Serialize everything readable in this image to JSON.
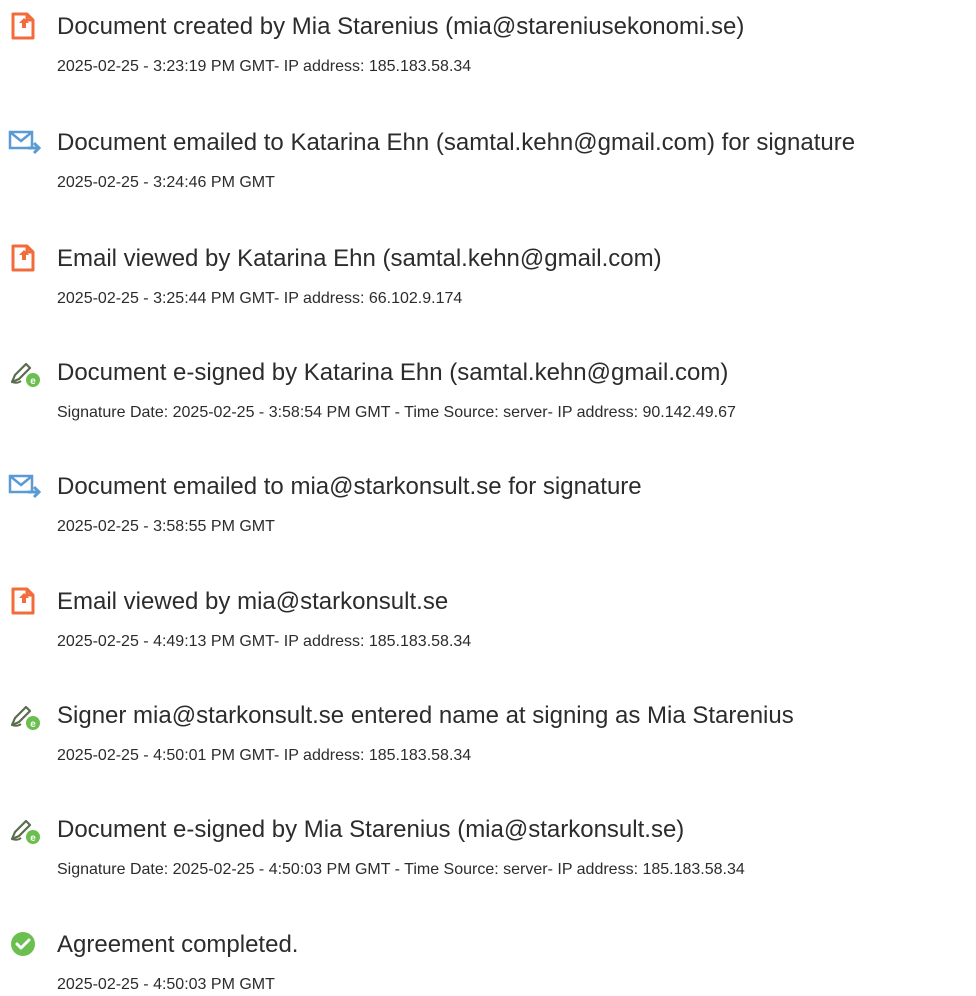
{
  "events": [
    {
      "icon": "document-created-icon",
      "title": "Document created by Mia Starenius (mia@stareniusekonomi.se)",
      "detail": "2025-02-25 - 3:23:19 PM GMT- IP address: 185.183.58.34"
    },
    {
      "icon": "email-sent-icon",
      "title": "Document emailed to Katarina Ehn (samtal.kehn@gmail.com) for signature",
      "detail": "2025-02-25 - 3:24:46 PM GMT"
    },
    {
      "icon": "document-viewed-icon",
      "title": "Email viewed by Katarina Ehn (samtal.kehn@gmail.com)",
      "detail": "2025-02-25 - 3:25:44 PM GMT- IP address: 66.102.9.174"
    },
    {
      "icon": "esign-pen-icon",
      "title": "Document e-signed by Katarina Ehn (samtal.kehn@gmail.com)",
      "detail": "Signature Date: 2025-02-25 - 3:58:54 PM GMT - Time Source: server- IP address: 90.142.49.67"
    },
    {
      "icon": "email-sent-icon",
      "title": "Document emailed to mia@starkonsult.se for signature",
      "detail": "2025-02-25 - 3:58:55 PM GMT"
    },
    {
      "icon": "document-viewed-icon",
      "title": "Email viewed by mia@starkonsult.se",
      "detail": "2025-02-25 - 4:49:13 PM GMT- IP address: 185.183.58.34"
    },
    {
      "icon": "esign-pen-icon",
      "title": "Signer mia@starkonsult.se entered name at signing as Mia Starenius",
      "detail": "2025-02-25 - 4:50:01 PM GMT- IP address: 185.183.58.34"
    },
    {
      "icon": "esign-pen-icon",
      "title": "Document e-signed by Mia Starenius (mia@starkonsult.se)",
      "detail": "Signature Date: 2025-02-25 - 4:50:03 PM GMT - Time Source: server- IP address: 185.183.58.34"
    },
    {
      "icon": "checkmark-circle-icon",
      "title": "Agreement completed.",
      "detail": "2025-02-25 - 4:50:03 PM GMT"
    }
  ],
  "colors": {
    "document_icon": "#f26b3a",
    "email_icon": "#5b9bd5",
    "pen_icon": "#6bbf4e",
    "check_icon": "#6bbf4e",
    "text": "#2c2c2c"
  }
}
